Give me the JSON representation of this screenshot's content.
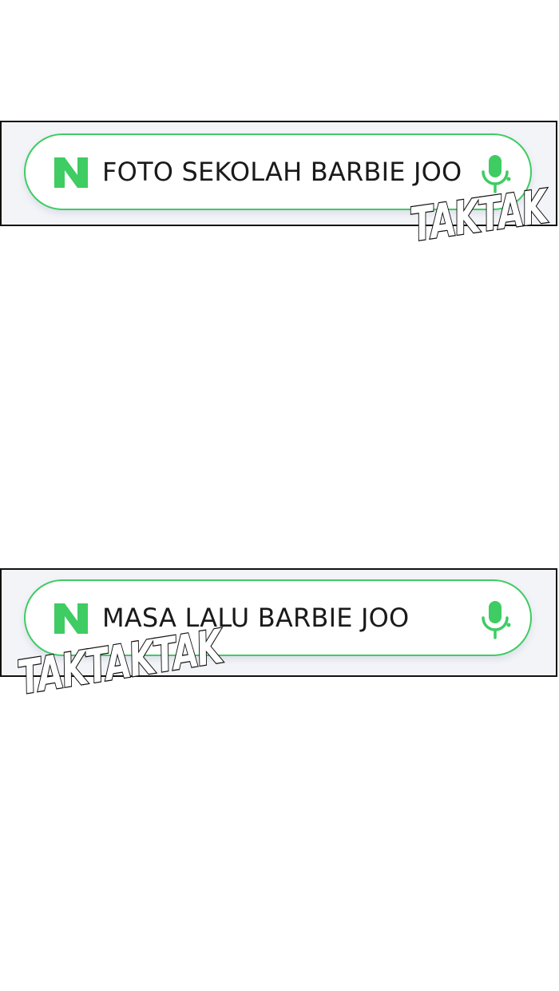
{
  "searches": [
    {
      "query": "FOTO SEKOLAH BARBIE JOO",
      "logo_letter": "N",
      "mic_icon": "microphone-icon"
    },
    {
      "query": "MASA LALU BARBIE JOO",
      "logo_letter": "N",
      "mic_icon": "microphone-icon"
    }
  ],
  "sound_effects": [
    {
      "text": "TAKTAK"
    },
    {
      "text": "TAKTAKTAK"
    }
  ],
  "colors": {
    "brand_green": "#3fcc63",
    "panel_background": "#f3f4f8",
    "border": "#111111"
  }
}
